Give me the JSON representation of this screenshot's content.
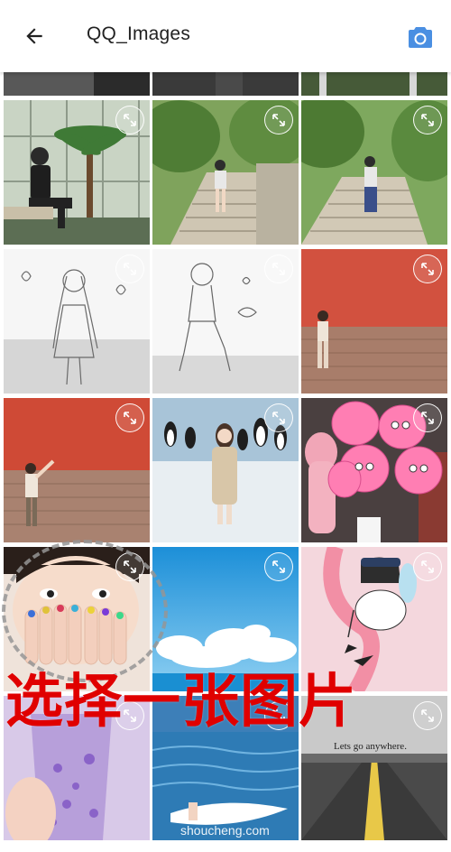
{
  "app_bar": {
    "title": "QQ_Images",
    "back_icon": "arrow-back-icon",
    "camera_icon": "camera-icon",
    "accent_color": "#4a8fe2"
  },
  "grid": {
    "columns": 3,
    "tiles": [
      {
        "id": "r0c0",
        "desc": "partial-photo",
        "has_expand": false
      },
      {
        "id": "r0c1",
        "desc": "partial-photo",
        "has_expand": false
      },
      {
        "id": "r0c2",
        "desc": "partial-photo",
        "has_expand": false
      },
      {
        "id": "r1c0",
        "desc": "man-in-greenhouse",
        "has_expand": true
      },
      {
        "id": "r1c1",
        "desc": "girl-on-stone-stairs",
        "has_expand": true
      },
      {
        "id": "r1c2",
        "desc": "girl-on-stone-stairs-2",
        "has_expand": true
      },
      {
        "id": "r2c0",
        "desc": "sketch-girl-standing",
        "has_expand": true
      },
      {
        "id": "r2c1",
        "desc": "sketch-girl-sitting",
        "has_expand": true
      },
      {
        "id": "r2c2",
        "desc": "girl-red-wall",
        "has_expand": true
      },
      {
        "id": "r3c0",
        "desc": "man-red-wall",
        "has_expand": true
      },
      {
        "id": "r3c1",
        "desc": "girl-with-penguins",
        "has_expand": true
      },
      {
        "id": "r3c2",
        "desc": "pink-balloons",
        "has_expand": true
      },
      {
        "id": "r4c0",
        "desc": "girl-hands-on-face",
        "has_expand": true
      },
      {
        "id": "r4c1",
        "desc": "blue-sky-clouds",
        "has_expand": true
      },
      {
        "id": "r4c2",
        "desc": "flamingo-illustration",
        "has_expand": true
      },
      {
        "id": "r5c0",
        "desc": "purple-drink",
        "has_expand": true
      },
      {
        "id": "r5c1",
        "desc": "surfing-ocean",
        "has_expand": true
      },
      {
        "id": "r5c2",
        "desc": "road-lets-go-anywhere",
        "has_expand": true
      }
    ],
    "expand_icon": "expand-icon"
  },
  "image_text": {
    "road_caption": "Lets go anywhere."
  },
  "overlay": {
    "caption": "选择一张图片",
    "caption_color": "#e00000",
    "watermark": "shoucheng.com"
  }
}
